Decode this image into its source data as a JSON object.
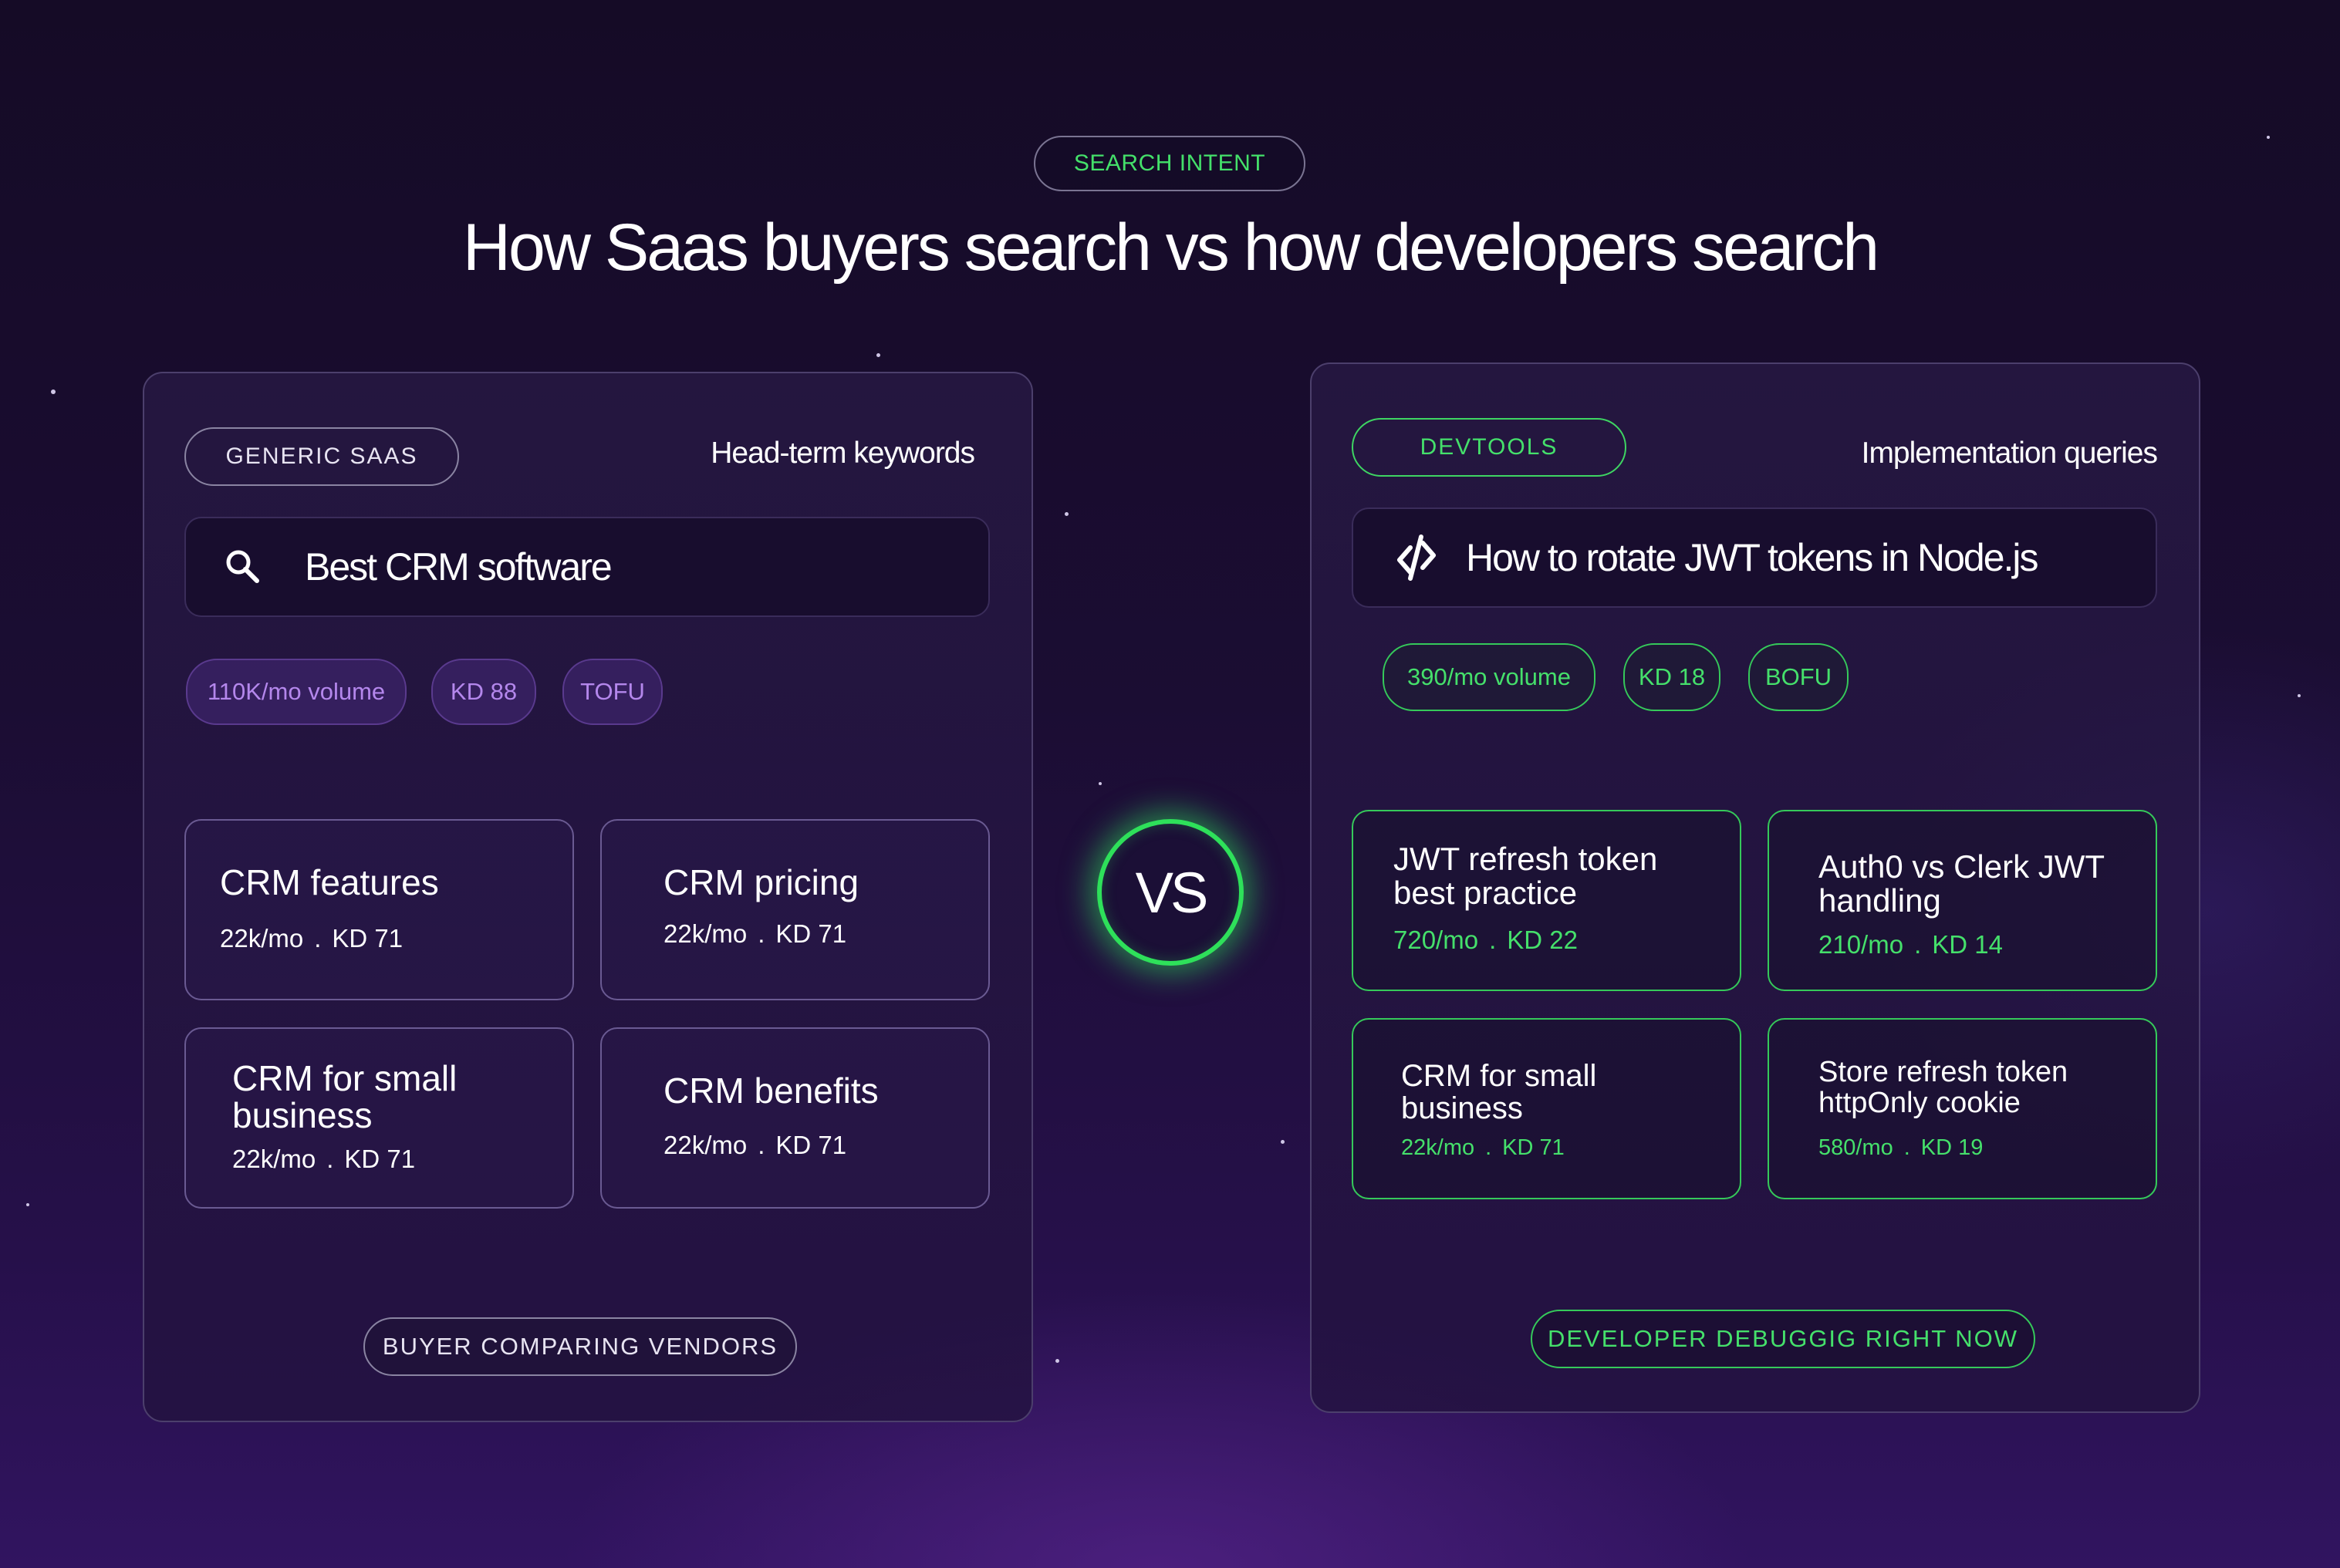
{
  "header": {
    "pill_label": "SEARCH INTENT",
    "title": "How Saas buyers search vs how developers search"
  },
  "vs_label": "VS",
  "left": {
    "tag": "GENERIC SAAS",
    "heading": "Head-term keywords",
    "search_icon": "search-icon",
    "query": "Best CRM software",
    "metrics": [
      "110K/mo volume",
      "KD 88",
      "TOFU"
    ],
    "cards": [
      {
        "title": "CRM features",
        "volume": "22k/mo",
        "sep": ".",
        "kd": "KD 71"
      },
      {
        "title": "CRM pricing",
        "volume": "22k/mo",
        "sep": ".",
        "kd": "KD 71"
      },
      {
        "title": "CRM for small\nbusiness",
        "volume": "22k/mo",
        "sep": ".",
        "kd": "KD 71"
      },
      {
        "title": "CRM benefits",
        "volume": "22k/mo",
        "sep": ".",
        "kd": "KD 71"
      }
    ],
    "footer": "BUYER COMPARING VENDORS"
  },
  "right": {
    "tag": "DEVTOOLS",
    "heading": "Implementation queries",
    "search_icon": "code-slash-icon",
    "query": "How to rotate JWT tokens in Node.js",
    "metrics": [
      "390/mo volume",
      "KD 18",
      "BOFU"
    ],
    "cards": [
      {
        "title": "JWT refresh token\nbest practice",
        "volume": "720/mo",
        "sep": ".",
        "kd": "KD 22"
      },
      {
        "title": "Auth0 vs Clerk JWT\nhandling",
        "volume": "210/mo",
        "sep": ".",
        "kd": "KD 14"
      },
      {
        "title": "CRM for small\nbusiness",
        "volume": "22k/mo",
        "sep": ".",
        "kd": "KD 71"
      },
      {
        "title": "Store refresh token\nhttpOnly cookie",
        "volume": "580/mo",
        "sep": ".",
        "kd": "KD 19"
      }
    ],
    "footer": "DEVELOPER DEBUGGIG RIGHT NOW"
  },
  "colors": {
    "accent_green": "#45e06b",
    "accent_purple": "#b487ec",
    "background": "#1b0d33"
  }
}
